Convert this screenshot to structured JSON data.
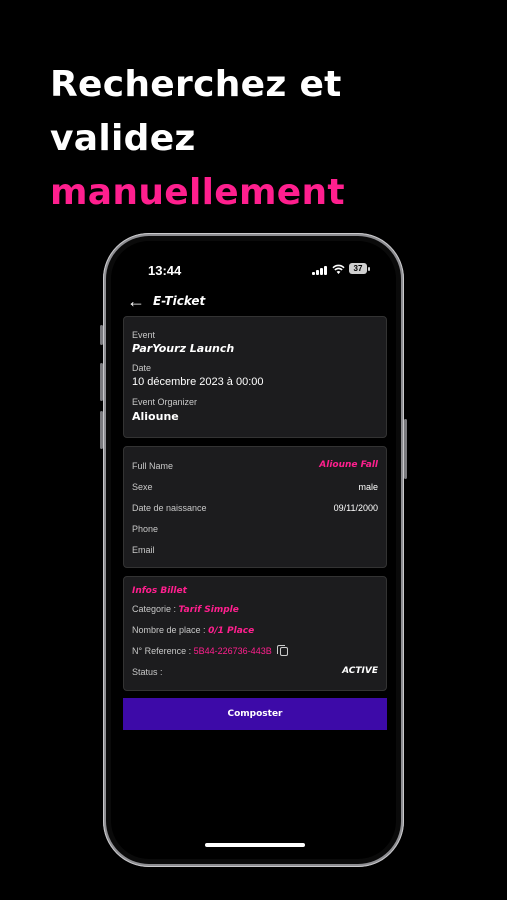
{
  "headline": {
    "line1": "Recherchez et",
    "line2": "validez",
    "line3": "manuellement"
  },
  "status_bar": {
    "time": "13:44",
    "battery": "37"
  },
  "appbar": {
    "title": "E-Ticket",
    "back_icon": "arrow-left-icon"
  },
  "event_card": {
    "event_label": "Event",
    "event_value": "ParYourz Launch",
    "date_label": "Date",
    "date_value": "10 décembre 2023 à 00:00",
    "organizer_label": "Event Organizer",
    "organizer_value": "Alioune"
  },
  "person_card": {
    "fullname_label": "Full Name",
    "fullname_value": "Alioune Fall",
    "sexe_label": "Sexe",
    "sexe_value": "male",
    "dob_label": "Date de naissance",
    "dob_value": "09/11/2000",
    "phone_label": "Phone",
    "email_label": "Email"
  },
  "ticket_card": {
    "title": "Infos Billet",
    "category_label": "Categorie :",
    "category_value": "Tarif Simple",
    "places_label": "Nombre de place :",
    "places_value": "0/1 Place",
    "reference_label": "N° Reference :",
    "reference_value": "5B44-226736-443B",
    "status_label": "Status :",
    "status_value": "ACTIVE"
  },
  "cta": {
    "label": "Composter"
  },
  "colors": {
    "accent": "#ff1f8e",
    "button": "#3d0aa8",
    "card": "#1c1c1e"
  }
}
